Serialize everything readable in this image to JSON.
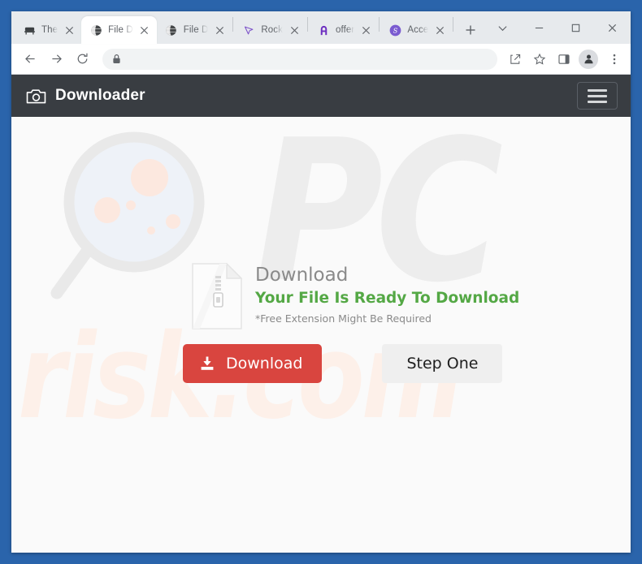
{
  "window": {
    "controls": [
      {
        "name": "tab-search",
        "icon": "chevron-down-icon",
        "label": "∨"
      },
      {
        "name": "minimize",
        "icon": "minimize-icon",
        "label": "—"
      },
      {
        "name": "maximize",
        "icon": "maximize-icon",
        "label": "□"
      },
      {
        "name": "close",
        "icon": "close-icon",
        "label": "✕"
      }
    ]
  },
  "tabs": [
    {
      "title": "The ",
      "favicon": "bench-icon",
      "active": false,
      "sep_after": false
    },
    {
      "title": "File D",
      "favicon": "globe-icon",
      "active": true,
      "sep_after": false
    },
    {
      "title": "File D",
      "favicon": "globe-icon",
      "active": false,
      "sep_after": true
    },
    {
      "title": "Rock",
      "favicon": "cursor-icon",
      "active": false,
      "sep_after": true
    },
    {
      "title": "offer",
      "favicon": "letter-a-icon",
      "active": false,
      "sep_after": true
    },
    {
      "title": "Acce",
      "favicon": "letter-s-circle-icon",
      "active": false,
      "sep_after": true
    }
  ],
  "new_tab": {
    "label": "+",
    "icon": "plus-icon"
  },
  "toolbar": {
    "back": {
      "label": "←",
      "icon": "arrow-left-icon"
    },
    "forward": {
      "label": "→",
      "icon": "arrow-right-icon"
    },
    "reload": {
      "label": "↻",
      "icon": "reload-icon"
    },
    "omnibox": {
      "value": "",
      "placeholder": "",
      "lock_icon": "lock-icon"
    },
    "share": {
      "icon": "share-icon"
    },
    "bookmark": {
      "icon": "star-icon"
    },
    "side_panel": {
      "icon": "side-panel-icon"
    },
    "profile": {
      "icon": "person-icon"
    },
    "menu": {
      "icon": "three-dots-icon"
    }
  },
  "site": {
    "header": {
      "brand_name": "Downloader",
      "brand_icon": "camera-icon",
      "menu_toggle_icon": "hamburger-icon"
    },
    "download_card": {
      "file_icon": "zip-file-icon",
      "title": "Download",
      "ready_text": "Your File Is Ready To Download",
      "note": "*Free Extension Might Be Required"
    },
    "buttons": {
      "download": {
        "label": "Download",
        "icon": "download-icon"
      },
      "step_one": {
        "label": "Step One"
      }
    },
    "watermark": {
      "text_pc": "PC",
      "text_risk": "risk.com",
      "glass_icon": "magnifier-icon"
    }
  },
  "colors": {
    "desktop_blue": "#2a64ab",
    "header_dark": "#393d42",
    "accent_red": "#d9453f",
    "accent_green": "#54a845",
    "tabstrip_gray": "#e7eaed",
    "watermark_gray": "#ededed",
    "watermark_peach": "#fdf0e9"
  }
}
